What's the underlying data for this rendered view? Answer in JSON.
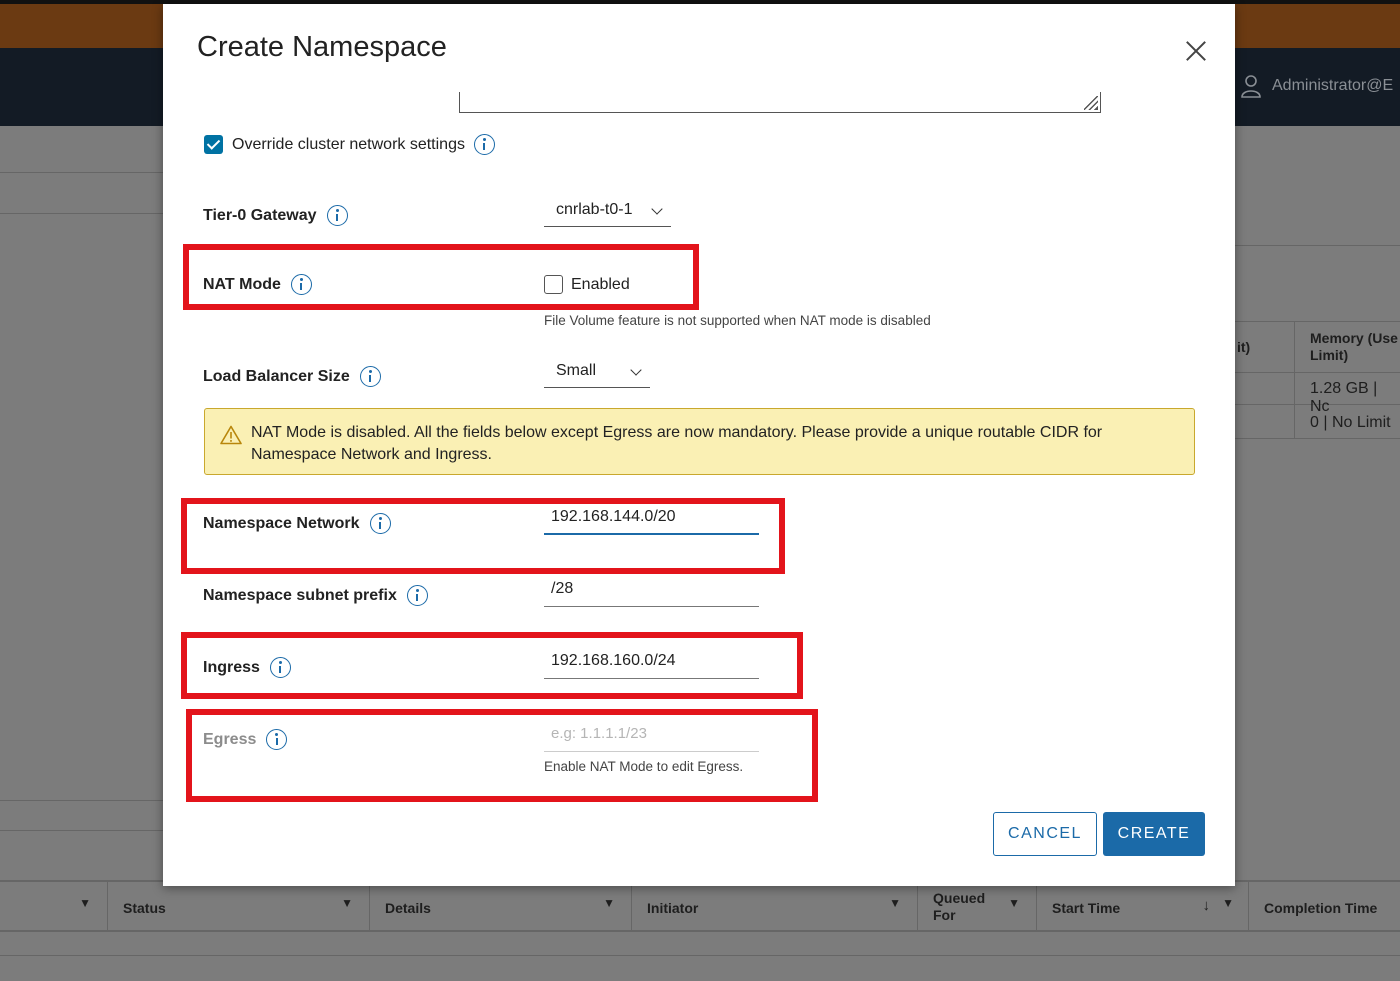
{
  "background": {
    "user_label": "Administrator@E",
    "table_header_partial": "it)",
    "memory_header": "Memory (Use\nLimit)",
    "memory_values": [
      "1.28 GB | Nc",
      "0 | No Limit"
    ],
    "task_columns": [
      "Status",
      "Details",
      "Initiator",
      "Queued\nFor",
      "Start Time",
      "Completion Time"
    ]
  },
  "modal": {
    "title": "Create Namespace",
    "override": {
      "label": "Override cluster network settings",
      "checked": true
    },
    "tier0": {
      "label": "Tier-0 Gateway",
      "value": "cnrlab-t0-1"
    },
    "nat_mode": {
      "label": "NAT Mode",
      "checkbox_label": "Enabled",
      "checked": false,
      "helper": "File Volume feature is not supported when NAT mode is disabled"
    },
    "lb_size": {
      "label": "Load Balancer Size",
      "value": "Small"
    },
    "alert": {
      "text": "NAT Mode is disabled. All the fields below except Egress are now mandatory. Please provide a unique routable CIDR for Namespace Network and Ingress."
    },
    "namespace_network": {
      "label": "Namespace Network",
      "value": "192.168.144.0/20"
    },
    "subnet_prefix": {
      "label": "Namespace subnet prefix",
      "value": "/28"
    },
    "ingress": {
      "label": "Ingress",
      "value": "192.168.160.0/24"
    },
    "egress": {
      "label": "Egress",
      "placeholder": "e.g: 1.1.1.1/23",
      "helper": "Enable NAT Mode to edit Egress."
    },
    "buttons": {
      "cancel": "CANCEL",
      "create": "CREATE"
    }
  },
  "colors": {
    "primary": "#1b6aa8",
    "highlight": "#e3141b",
    "alert_bg": "#faf0b4"
  }
}
